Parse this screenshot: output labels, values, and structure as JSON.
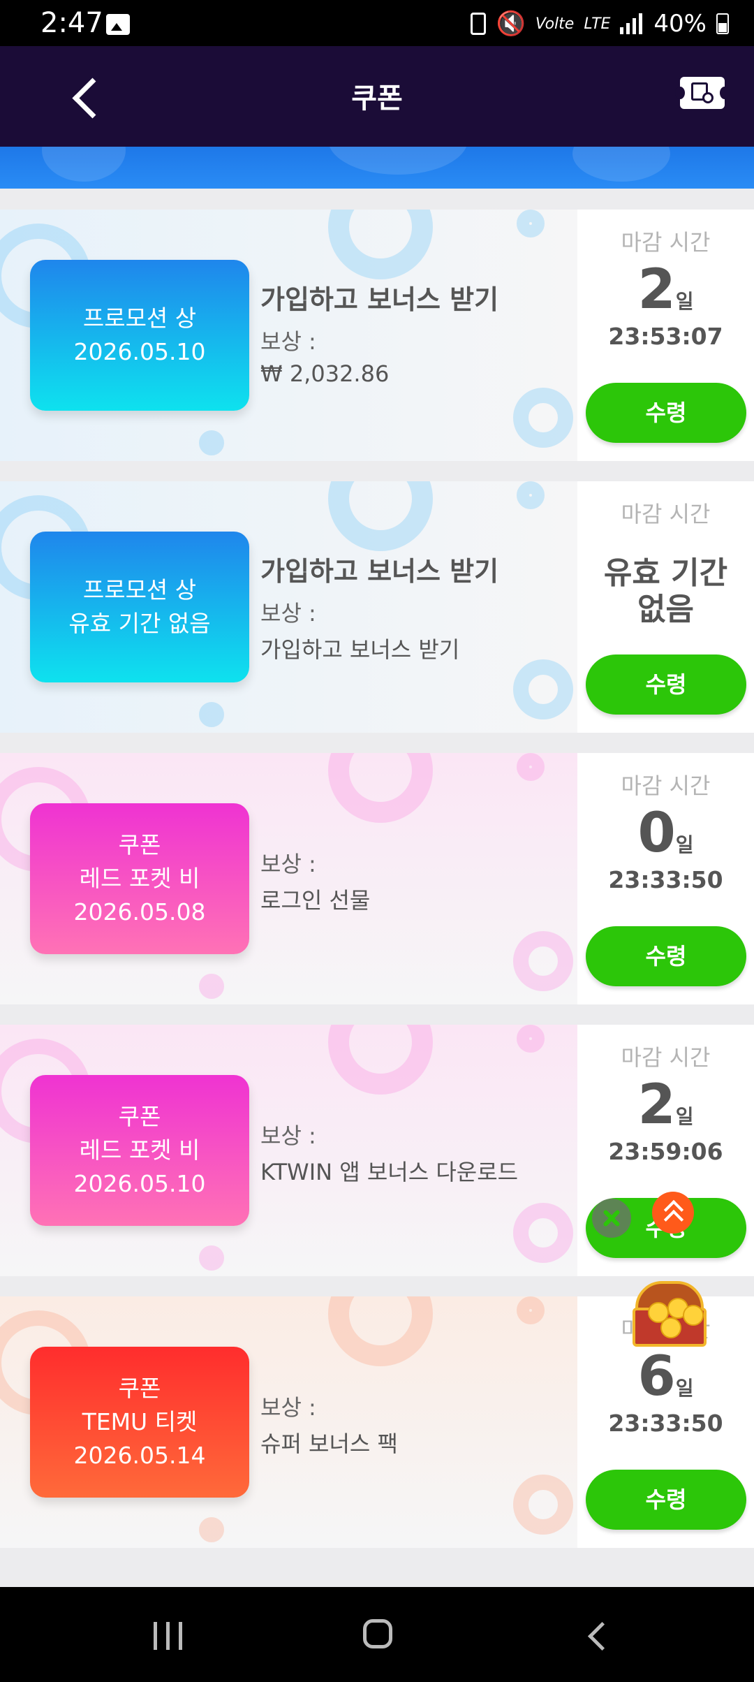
{
  "status_bar": {
    "time": "2:47",
    "network": "LTE",
    "volte": "Volte",
    "battery": "40%"
  },
  "header": {
    "title": "쿠폰"
  },
  "labels": {
    "deadline": "마감 시간",
    "reward": "보상 :",
    "claim": "수령",
    "day_unit": "일"
  },
  "coupons": [
    {
      "badge": [
        "프로모션 상",
        "2026.05.10"
      ],
      "title": "가입하고 보너스 받기",
      "reward": "₩ 2,032.86",
      "days": "2",
      "timer": "23:53:07",
      "no_expiry": "",
      "theme": "blue"
    },
    {
      "badge": [
        "프로모션 상",
        "유효 기간 없음"
      ],
      "title": "가입하고 보너스 받기",
      "reward": "가입하고 보너스 받기",
      "days": "",
      "timer": "",
      "no_expiry": "유효 기간 없음",
      "theme": "blue"
    },
    {
      "badge": [
        "쿠폰",
        "레드 포켓 비",
        "2026.05.08"
      ],
      "title": "",
      "reward": "로그인 선물",
      "days": "0",
      "timer": "23:33:50",
      "no_expiry": "",
      "theme": "pink"
    },
    {
      "badge": [
        "쿠폰",
        "레드 포켓 비",
        "2026.05.10"
      ],
      "title": "",
      "reward": "KTWIN 앱 보너스 다운로드",
      "days": "2",
      "timer": "23:59:06",
      "no_expiry": "",
      "theme": "pink"
    },
    {
      "badge": [
        "쿠폰",
        "TEMU 티켓",
        "2026.05.14"
      ],
      "title": "",
      "reward": "슈퍼 보너스 팩",
      "days": "6",
      "timer": "23:33:50",
      "no_expiry": "",
      "theme": "red"
    }
  ],
  "themes": {
    "blue": {
      "badge": "linear-gradient(180deg,#1f86ec,#0ee2ee)",
      "bg": "linear-gradient(90deg,#e7f2fa,#f6f6f7)",
      "deco": "rgba(120,200,245,0.35)"
    },
    "pink": {
      "badge": "linear-gradient(180deg,#ef33d2,#ff72b5)",
      "bg": "linear-gradient(180deg,#fbe6f5,#f6f6f7)",
      "deco": "rgba(250,150,225,0.35)"
    },
    "red": {
      "badge": "linear-gradient(180deg,#ff2d2d,#ff6a3a)",
      "bg": "linear-gradient(180deg,#fbece4,#f6f6f7)",
      "deco": "rgba(250,170,140,0.35)"
    }
  },
  "colors": {
    "claim_button": "#2cc609",
    "app_bar": "#1b0c37",
    "banner": "#1e78e8"
  }
}
